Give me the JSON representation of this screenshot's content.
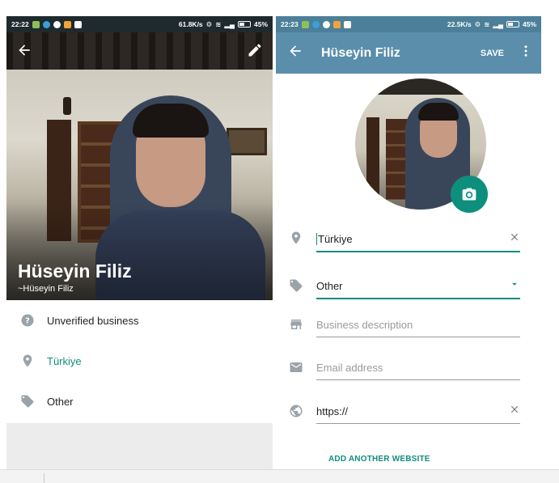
{
  "left": {
    "status": {
      "time": "22:22",
      "speed": "61.8K/s",
      "battery": "45%"
    },
    "profile": {
      "name": "Hüseyin Filiz",
      "pushname": "~Hüseyin Filiz"
    },
    "info": [
      {
        "label": "Unverified business",
        "icon": "help-circle-icon"
      },
      {
        "label": "Türkiye",
        "icon": "location-pin-icon"
      },
      {
        "label": "Other",
        "icon": "tag-icon"
      }
    ]
  },
  "right": {
    "status": {
      "time": "22:23",
      "speed": "22.5K/s",
      "battery": "45%"
    },
    "appbar": {
      "title": "Hüseyin Filiz",
      "save_label": "SAVE"
    },
    "fields": {
      "location": {
        "value": "Türkiye"
      },
      "category": {
        "value": "Other"
      },
      "description": {
        "placeholder": "Business description"
      },
      "email": {
        "placeholder": "Email address"
      },
      "website": {
        "value": "https://"
      }
    },
    "add_website_label": "ADD ANOTHER WEBSITE"
  },
  "colors": {
    "accent": "#128c7e",
    "appbar": "#5a8eab",
    "statusbar_right": "#4c7f99",
    "statusbar_left": "#1f2a2e"
  }
}
